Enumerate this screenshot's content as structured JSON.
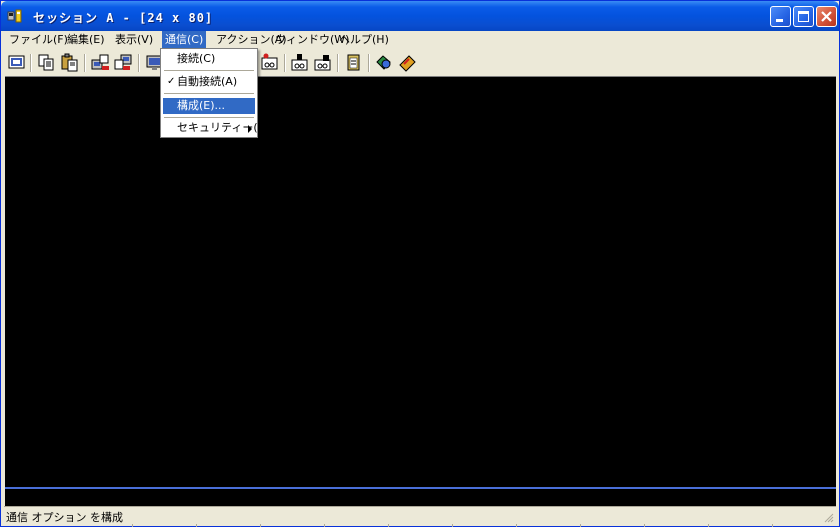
{
  "window": {
    "title": "セッション A - [24 x 80]"
  },
  "menubar": {
    "items": [
      {
        "label": "ファイル(F)"
      },
      {
        "label": "編集(E)"
      },
      {
        "label": "表示(V)"
      },
      {
        "label": "通信(C)"
      },
      {
        "label": "アクション(A)"
      },
      {
        "label": "ウィンドウ(W)"
      },
      {
        "label": "ヘルプ(H)"
      }
    ]
  },
  "dropdown": {
    "items": [
      {
        "label": "接続(C)"
      },
      {
        "label": "自動接続(A)",
        "check": "✓"
      },
      {
        "label": "構成(E)..."
      },
      {
        "label": "セキュリティー(S)"
      }
    ]
  },
  "toolbar": {
    "buttons": [
      "screen-icon",
      "copy-icon",
      "paste-icon",
      "send-icon",
      "receive-icon",
      "display-icon",
      "record-icon",
      "play-macro-icon",
      "run-macro-icon",
      "clipboard-icon",
      "globe-icon",
      "keymap-icon"
    ]
  },
  "statusbar": {
    "text": "通信 オプション を構成"
  },
  "colors": {
    "titlebar": "#0453de",
    "menu_highlight": "#316ac5",
    "terminal_bg": "#000000",
    "chrome": "#ece9d8"
  }
}
